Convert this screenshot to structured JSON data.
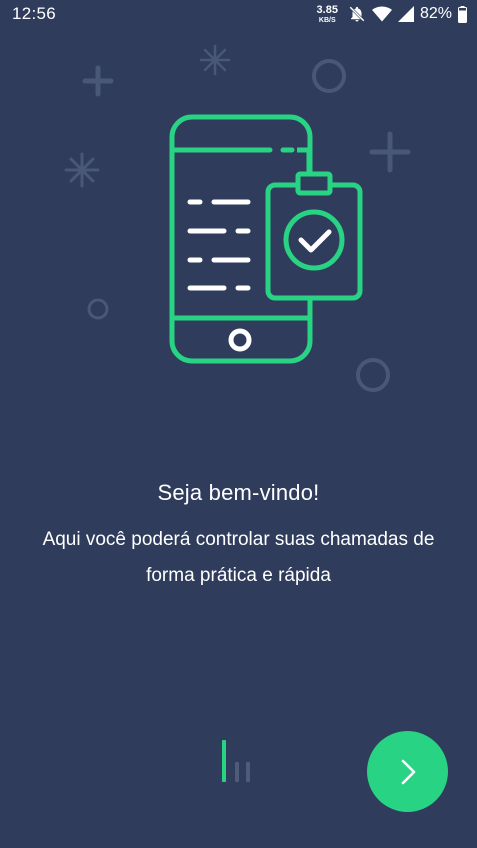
{
  "status_bar": {
    "time": "12:56",
    "net_speed_value": "3.85",
    "net_speed_unit": "KB/S",
    "battery_percent": "82%",
    "icons": [
      "bell-off-icon",
      "wifi-icon",
      "signal-icon",
      "battery-icon"
    ]
  },
  "onboarding": {
    "title": "Seja bem-vindo!",
    "description": "Aqui você poderá controlar suas chamadas de forma prática e rápida",
    "illustration_icon": "phone-clipboard-check-icon",
    "page_indicator": {
      "current": 1,
      "total": 3
    },
    "next_button_icon": "chevron-right-icon"
  },
  "colors": {
    "background": "#2f3c5b",
    "accent": "#28d483",
    "text": "#ffffff",
    "decor": "#4a5877"
  }
}
